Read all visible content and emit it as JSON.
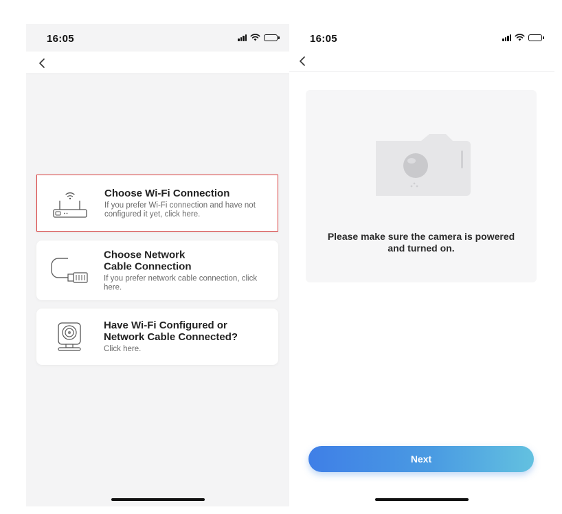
{
  "left_screen": {
    "status_bar": {
      "time": "16:05"
    },
    "options": [
      {
        "title": "Choose Wi-Fi Connection",
        "description": "If you prefer Wi-Fi connection and have not configured it yet, click here."
      },
      {
        "title": "Choose Network Cable Connection",
        "description": "If you prefer network cable connection, click here."
      },
      {
        "title": "Have Wi-Fi Configured or Network Cable Connected?",
        "description": "Click here."
      }
    ]
  },
  "right_screen": {
    "status_bar": {
      "time": "16:05"
    },
    "hint": "Please make sure the camera is powered and turned on.",
    "next_label": "Next"
  },
  "colors": {
    "selected_border": "#d83a3a",
    "button_gradient_start": "#3f7fe7",
    "button_gradient_end": "#63c1e0"
  }
}
